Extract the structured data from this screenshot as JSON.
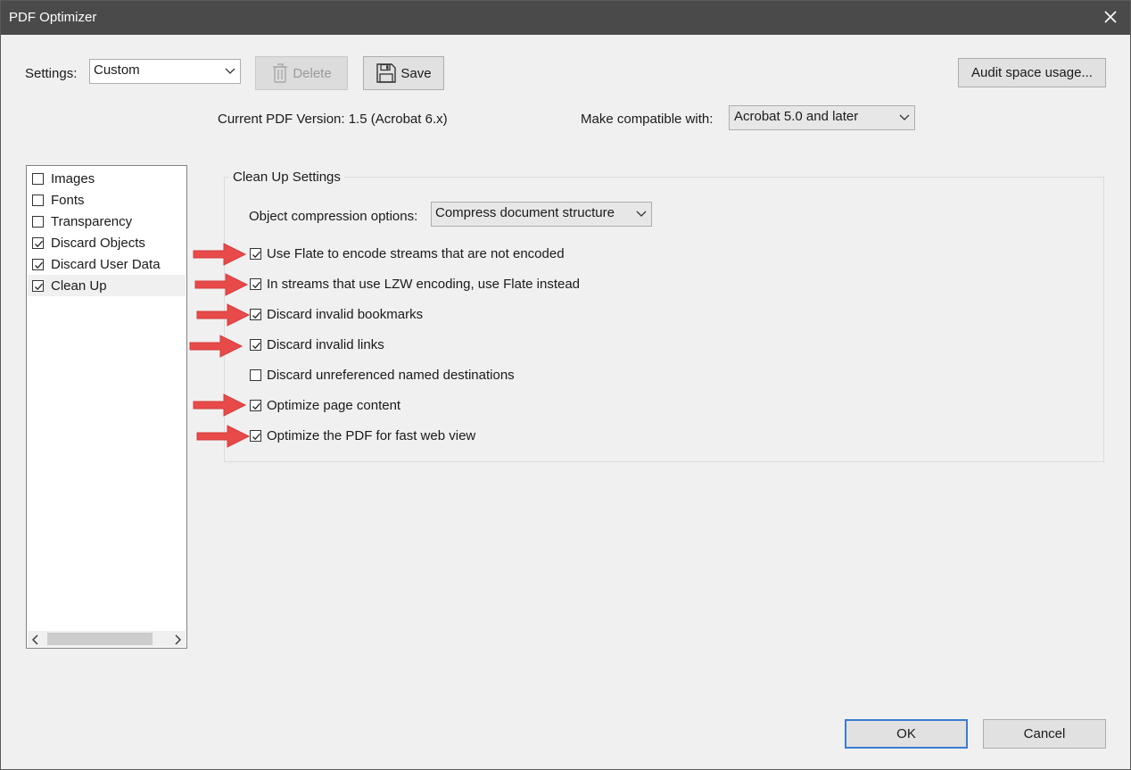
{
  "window": {
    "title": "PDF Optimizer"
  },
  "settings": {
    "label": "Settings:",
    "value": "Custom"
  },
  "toolbar": {
    "delete_label": "Delete",
    "save_label": "Save",
    "audit_label": "Audit space usage..."
  },
  "version": {
    "current_label": "Current PDF Version: 1.5 (Acrobat 6.x)",
    "compat_label": "Make compatible with:",
    "compat_value": "Acrobat 5.0 and later"
  },
  "sidebar": {
    "items": [
      {
        "label": "Images",
        "checked": false
      },
      {
        "label": "Fonts",
        "checked": false
      },
      {
        "label": "Transparency",
        "checked": false
      },
      {
        "label": "Discard Objects",
        "checked": true
      },
      {
        "label": "Discard User Data",
        "checked": true
      },
      {
        "label": "Clean Up",
        "checked": true,
        "selected": true
      }
    ]
  },
  "cleanup": {
    "group_title": "Clean Up Settings",
    "compression_label": "Object compression options:",
    "compression_value": "Compress document structure",
    "options": [
      {
        "label": "Use Flate to encode streams that are not encoded",
        "checked": true,
        "marked": true
      },
      {
        "label": "In streams that use LZW encoding, use Flate instead",
        "checked": true,
        "marked": true
      },
      {
        "label": "Discard invalid bookmarks",
        "checked": true,
        "marked": true
      },
      {
        "label": "Discard invalid links",
        "checked": true,
        "marked": true
      },
      {
        "label": "Discard unreferenced named destinations",
        "checked": false,
        "marked": false
      },
      {
        "label": "Optimize page content",
        "checked": true,
        "marked": true
      },
      {
        "label": "Optimize the PDF for fast web view",
        "checked": true,
        "marked": true
      }
    ]
  },
  "footer": {
    "ok_label": "OK",
    "cancel_label": "Cancel"
  },
  "colors": {
    "titlebar": "#4a4a4a",
    "arrow": "#e84a4a",
    "default_button_border": "#3b7bd0"
  }
}
